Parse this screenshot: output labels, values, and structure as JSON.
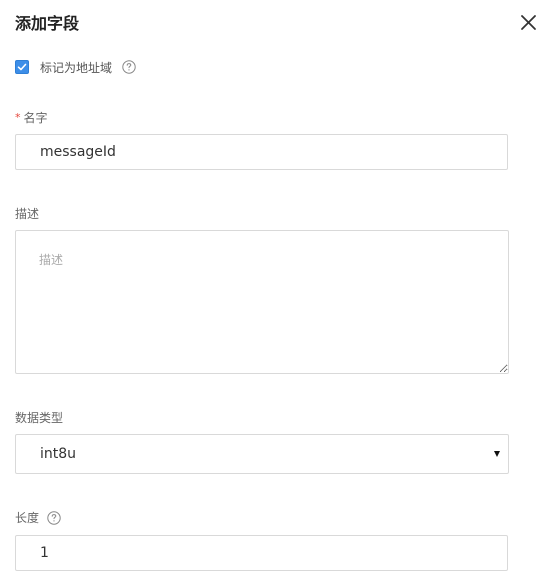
{
  "dialog": {
    "title": "添加字段",
    "close_icon": "close-icon"
  },
  "address_domain": {
    "label": "标记为地址域",
    "checked": true,
    "help_icon": "question-circle-icon"
  },
  "fields": {
    "name": {
      "required_mark": "*",
      "label": "名字",
      "value": "messageId"
    },
    "description": {
      "label": "描述",
      "value": "",
      "placeholder": "描述"
    },
    "data_type": {
      "label": "数据类型",
      "selected": "int8u"
    },
    "length": {
      "label": "长度",
      "value": "1",
      "help_icon": "question-circle-icon"
    }
  },
  "colors": {
    "accent": "#3d8ee8",
    "required": "#e5463b",
    "border": "#d9d9d9"
  }
}
